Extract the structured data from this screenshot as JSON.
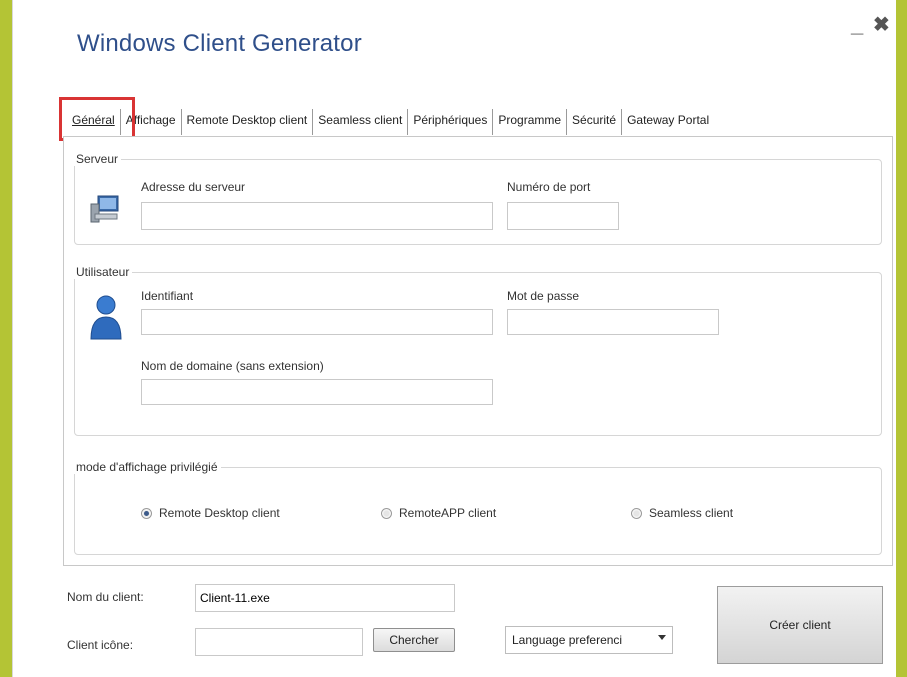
{
  "window": {
    "title": "Windows Client Generator",
    "minimize_glyph": "_",
    "close_glyph": "✖"
  },
  "tabs": [
    {
      "label": "Général",
      "active": true
    },
    {
      "label": "Affichage"
    },
    {
      "label": "Remote Desktop client"
    },
    {
      "label": "Seamless client"
    },
    {
      "label": "Périphériques"
    },
    {
      "label": "Programme"
    },
    {
      "label": "Sécurité"
    },
    {
      "label": "Gateway Portal"
    }
  ],
  "serveur": {
    "legend": "Serveur",
    "icon": "server-computer-icon",
    "address_label": "Adresse du serveur",
    "address_value": "",
    "port_label": "Numéro de port",
    "port_value": ""
  },
  "utilisateur": {
    "legend": "Utilisateur",
    "icon": "user-icon",
    "id_label": "Identifiant",
    "id_value": "",
    "password_label": "Mot de passe",
    "password_value": "",
    "domain_label": "Nom de domaine (sans extension)",
    "domain_value": ""
  },
  "display_mode": {
    "legend": "mode d'affichage privilégié",
    "options": [
      {
        "label": "Remote Desktop client",
        "checked": true
      },
      {
        "label": "RemoteAPP client",
        "checked": false
      },
      {
        "label": "Seamless client",
        "checked": false
      }
    ]
  },
  "footer": {
    "client_name_label": "Nom du client:",
    "client_name_value": "Client-11.exe",
    "client_icon_label": "Client icône:",
    "client_icon_value": "",
    "browse_button": "Chercher",
    "language_select": "Language preferenci",
    "create_button": "Créer client"
  },
  "colors": {
    "title": "#2f4f8a",
    "highlight": "#d93434",
    "frame": "#b8c83a"
  }
}
